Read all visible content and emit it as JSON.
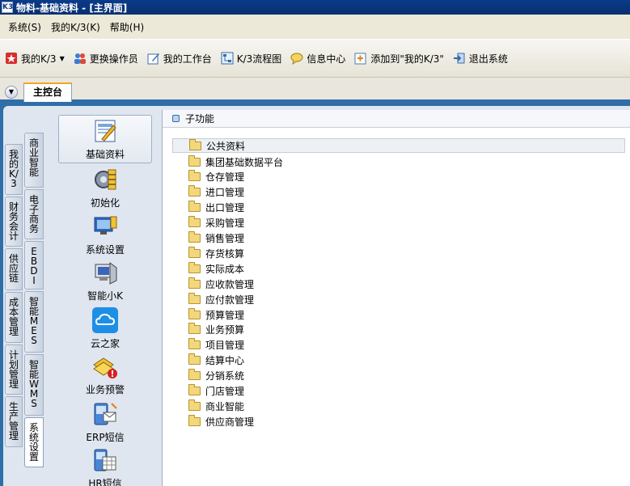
{
  "window": {
    "title": "物料-基础资料 - [主界面]",
    "app_icon_text": "K3"
  },
  "menubar": {
    "items": [
      "系统(S)",
      "我的K/3(K)",
      "帮助(H)"
    ]
  },
  "toolbar": {
    "items": [
      {
        "label": "我的K/3",
        "icon": "star-icon",
        "has_dropdown": true
      },
      {
        "label": "更换操作员",
        "icon": "users-icon"
      },
      {
        "label": "我的工作台",
        "icon": "edit-icon"
      },
      {
        "label": "K/3流程图",
        "icon": "flowchart-icon"
      },
      {
        "label": "信息中心",
        "icon": "message-icon"
      },
      {
        "label": "添加到\"我的K/3\"",
        "icon": "add-favorite-icon"
      },
      {
        "label": "退出系统",
        "icon": "exit-icon"
      }
    ]
  },
  "tabs": {
    "main_label": "主控台"
  },
  "vtabs_left": [
    "我的K/3",
    "财务会计",
    "供应链",
    "成本管理",
    "计划管理",
    "生产管理"
  ],
  "vtabs_right": [
    "商业智能",
    "电子商务",
    "EBDI",
    "智能MES",
    "智能WMS",
    "系统设置"
  ],
  "iconpanel": {
    "items": [
      {
        "label": "基础资料",
        "icon": "basic-data-icon"
      },
      {
        "label": "初始化",
        "icon": "gear-init-icon"
      },
      {
        "label": "系统设置",
        "icon": "system-settings-icon"
      },
      {
        "label": "智能小K",
        "icon": "assistant-icon"
      },
      {
        "label": "云之家",
        "icon": "cloud-icon"
      },
      {
        "label": "业务预警",
        "icon": "alert-icon"
      },
      {
        "label": "ERP短信",
        "icon": "sms-icon"
      },
      {
        "label": "HR短信",
        "icon": "hr-sms-icon"
      }
    ]
  },
  "content": {
    "header": "子功能",
    "folders": [
      "公共资料",
      "集团基础数据平台",
      "仓存管理",
      "进口管理",
      "出口管理",
      "采购管理",
      "销售管理",
      "存货核算",
      "实际成本",
      "应收款管理",
      "应付款管理",
      "预算管理",
      "业务预算",
      "项目管理",
      "结算中心",
      "分销系统",
      "门店管理",
      "商业智能",
      "供应商管理"
    ]
  },
  "colors": {
    "accent": "#2f6ea8",
    "title_bar": "#0b3a8a",
    "tab_highlight": "#f5a623"
  }
}
